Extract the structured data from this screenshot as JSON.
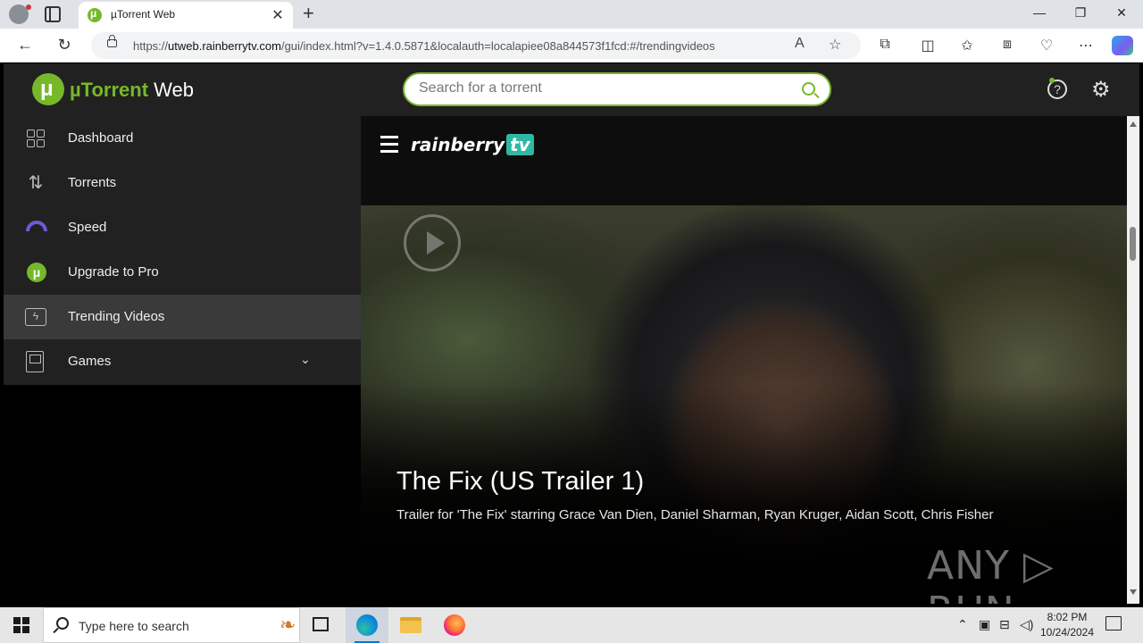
{
  "browser": {
    "tab_title": "µTorrent Web",
    "url_prefix": "https://",
    "url_host": "utweb.rainberrytv.com",
    "url_path": "/gui/index.html?v=1.4.0.5871&localauth=localapiee08a844573f1fcd:#/trendingvideos",
    "new_tab_label": "+",
    "tab_close_label": "✕"
  },
  "app": {
    "logo_prefix": "µTorrent",
    "logo_suffix": " Web",
    "search_placeholder": "Search for a torrent",
    "help_label": "?",
    "accent_color": "#76b82a"
  },
  "sidebar": {
    "items": [
      {
        "label": "Dashboard",
        "icon": "dashboard-grid-icon"
      },
      {
        "label": "Torrents",
        "icon": "up-down-arrows-icon"
      },
      {
        "label": "Speed",
        "icon": "speedometer-icon"
      },
      {
        "label": "Upgrade to Pro",
        "icon": "utorrent-logo-icon"
      },
      {
        "label": "Trending Videos",
        "icon": "trending-video-icon",
        "active": true
      },
      {
        "label": "Games",
        "icon": "gameboy-icon",
        "expandable": true
      }
    ]
  },
  "rainberry": {
    "logo_text": "rainberry",
    "logo_tv": "tv",
    "video_title": "The Fix (US Trailer 1)",
    "video_description": "Trailer for 'The Fix' starring Grace Van Dien, Daniel Sharman, Ryan Kruger, Aidan Scott, Chris Fisher",
    "watermark": "ANY ▷ RUN"
  },
  "taskbar": {
    "search_placeholder": "Type here to search",
    "time": "8:02 PM",
    "date": "10/24/2024"
  }
}
